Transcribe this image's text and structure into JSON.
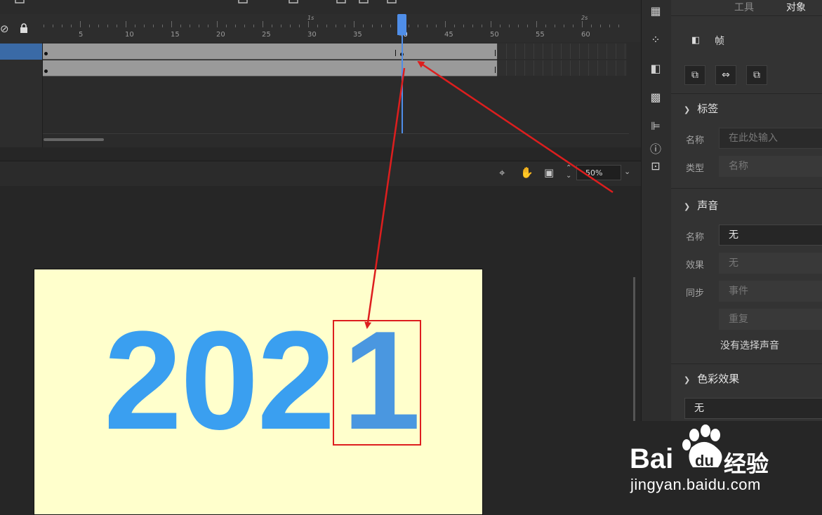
{
  "timeline": {
    "ruler_seconds": [
      "1s",
      "2s"
    ],
    "ruler_numbers": [
      "5",
      "10",
      "15",
      "20",
      "25",
      "30",
      "35",
      "40",
      "45",
      "50",
      "55",
      "60"
    ],
    "current_frame": "40"
  },
  "stage_toolbar": {
    "zoom": "50%"
  },
  "stage": {
    "text_main": "202",
    "text_highlight": "1",
    "background": "#ffffcc",
    "text_color": "#3a9ff0"
  },
  "properties": {
    "tabs": [
      "工具",
      "对象"
    ],
    "frame_label": "帧",
    "label_section": {
      "title": "标签",
      "name_label": "名称",
      "name_placeholder": "在此处输入",
      "type_label": "类型",
      "type_value": "名称"
    },
    "sound_section": {
      "title": "声音",
      "name_label": "名称",
      "name_value": "无",
      "effect_label": "效果",
      "effect_value": "无",
      "sync_label": "同步",
      "sync_value": "事件",
      "repeat_value": "重复",
      "no_sound": "没有选择声音"
    },
    "color_section": {
      "title": "色彩效果",
      "value": "无"
    }
  },
  "watermark": {
    "brand": "Bai",
    "brand_du": "du",
    "brand_cn": "经验",
    "url": "jingyan.baidu.com"
  },
  "colors": {
    "accent": "#4f8ee8",
    "annotation": "#dd1e1e"
  }
}
